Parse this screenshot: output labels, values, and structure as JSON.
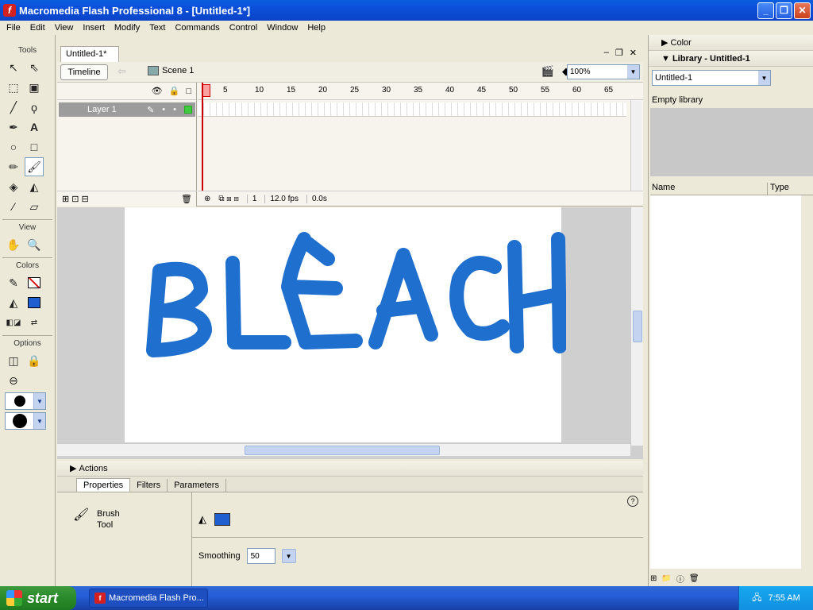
{
  "window": {
    "title": "Macromedia Flash Professional 8 - [Untitled-1*]",
    "app_icon": "flash-logo-icon"
  },
  "menu": [
    "File",
    "Edit",
    "View",
    "Insert",
    "Modify",
    "Text",
    "Commands",
    "Control",
    "Window",
    "Help"
  ],
  "tools": {
    "title": "Tools",
    "view_label": "View",
    "colors_label": "Colors",
    "options_label": "Options"
  },
  "document": {
    "tab": "Untitled-1*",
    "timeline_btn": "Timeline",
    "scene": "Scene 1",
    "zoom": "100%"
  },
  "timeline": {
    "layer_name": "Layer 1",
    "ruler": [
      "1",
      "5",
      "10",
      "15",
      "20",
      "25",
      "30",
      "35",
      "40",
      "45",
      "50",
      "55",
      "60",
      "65"
    ],
    "current_frame": "1",
    "fps": "12.0 fps",
    "elapsed": "0.0s"
  },
  "stage": {
    "drawing_text": "BLEACH",
    "stroke_color": "#1f6fcf"
  },
  "panels": {
    "actions": "Actions",
    "tabs": [
      "Properties",
      "Filters",
      "Parameters"
    ],
    "tool_line1": "Brush",
    "tool_line2": "Tool",
    "smoothing_label": "Smoothing",
    "smoothing_value": "50",
    "fill_color": "#1f5fcf"
  },
  "right": {
    "color": "Color",
    "library": "Library - Untitled-1",
    "library_select": "Untitled-1",
    "empty": "Empty library",
    "col_name": "Name",
    "col_type": "Type"
  },
  "taskbar": {
    "start": "start",
    "task": "Macromedia Flash Pro...",
    "time": "7:55 AM"
  }
}
